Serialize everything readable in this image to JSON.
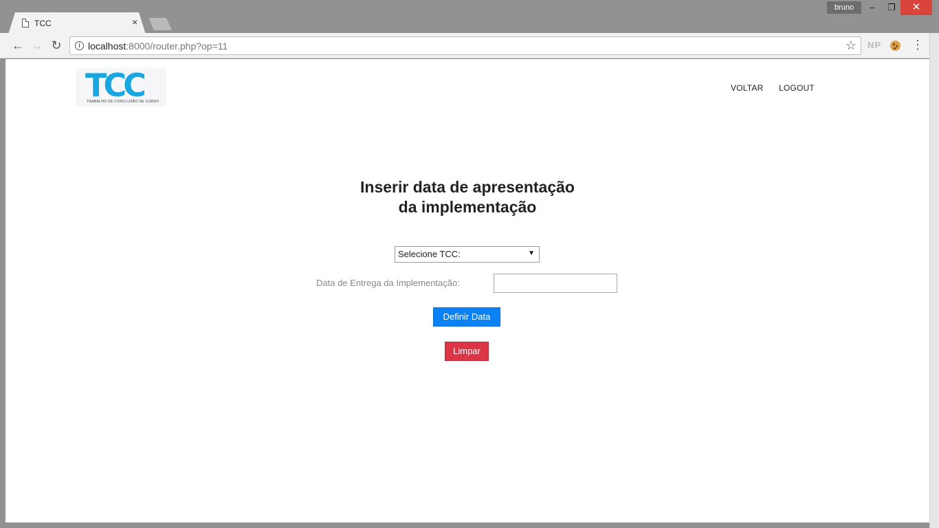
{
  "browser": {
    "tab_title": "TCC",
    "tab_close": "×",
    "profile_name": "bruno",
    "window_minimize": "–",
    "window_maximize": "❐",
    "window_close": "✕",
    "url_host": "localhost",
    "url_rest": ":8000/router.php?op=11",
    "info_glyph": "i",
    "ext_np": "NP"
  },
  "header": {
    "logo_text": "TCC",
    "logo_subtitle": "TRABALHO DE CONCLUSÃO DE CURSO",
    "nav": {
      "voltar": "VOLTAR",
      "logout": "LOGOUT"
    }
  },
  "main": {
    "title_line1": "Inserir data de apresentação",
    "title_line2": "da implementação",
    "select_value": "Selecione TCC:",
    "date_label": "Data de Entrega da Implementação:",
    "date_value": "",
    "definir_label": "Definir Data",
    "limpar_label": "Limpar"
  },
  "colors": {
    "primary": "#0a82f6",
    "danger": "#dc3545",
    "logo": "#1aa6de"
  }
}
